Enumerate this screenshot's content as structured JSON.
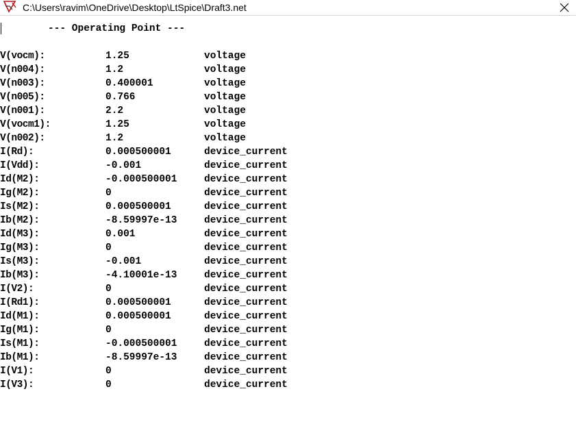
{
  "window": {
    "title": "C:\\Users\\ravim\\OneDrive\\Desktop\\LtSpice\\Draft3.net",
    "close_icon": "close-icon",
    "app_icon": "ltspice-app-icon"
  },
  "content": {
    "header": "--- Operating Point ---",
    "rows": [
      {
        "name": "V(vocm):",
        "value": "1.25",
        "type": "voltage"
      },
      {
        "name": "V(n004):",
        "value": "1.2",
        "type": "voltage"
      },
      {
        "name": "V(n003):",
        "value": "0.400001",
        "type": "voltage"
      },
      {
        "name": "V(n005):",
        "value": "0.766",
        "type": "voltage"
      },
      {
        "name": "V(n001):",
        "value": "2.2",
        "type": "voltage"
      },
      {
        "name": "V(vocm1):",
        "value": "1.25",
        "type": "voltage"
      },
      {
        "name": "V(n002):",
        "value": "1.2",
        "type": "voltage"
      },
      {
        "name": "I(Rd):",
        "value": "0.000500001",
        "type": "device_current"
      },
      {
        "name": "I(Vdd):",
        "value": "-0.001",
        "type": "device_current"
      },
      {
        "name": "Id(M2):",
        "value": "-0.000500001",
        "type": "device_current"
      },
      {
        "name": "Ig(M2):",
        "value": "0",
        "type": "device_current"
      },
      {
        "name": "Is(M2):",
        "value": "0.000500001",
        "type": "device_current"
      },
      {
        "name": "Ib(M2):",
        "value": "-8.59997e-13",
        "type": "device_current"
      },
      {
        "name": "Id(M3):",
        "value": "0.001",
        "type": "device_current"
      },
      {
        "name": "Ig(M3):",
        "value": "0",
        "type": "device_current"
      },
      {
        "name": "Is(M3):",
        "value": "-0.001",
        "type": "device_current"
      },
      {
        "name": "Ib(M3):",
        "value": "-4.10001e-13",
        "type": "device_current"
      },
      {
        "name": "I(V2):",
        "value": "0",
        "type": "device_current"
      },
      {
        "name": "I(Rd1):",
        "value": "0.000500001",
        "type": "device_current"
      },
      {
        "name": "Id(M1):",
        "value": "0.000500001",
        "type": "device_current"
      },
      {
        "name": "Ig(M1):",
        "value": "0",
        "type": "device_current"
      },
      {
        "name": "Is(M1):",
        "value": "-0.000500001",
        "type": "device_current"
      },
      {
        "name": "Ib(M1):",
        "value": "-8.59997e-13",
        "type": "device_current"
      },
      {
        "name": "I(V1):",
        "value": "0",
        "type": "device_current"
      },
      {
        "name": "I(V3):",
        "value": "0",
        "type": "device_current"
      }
    ]
  }
}
